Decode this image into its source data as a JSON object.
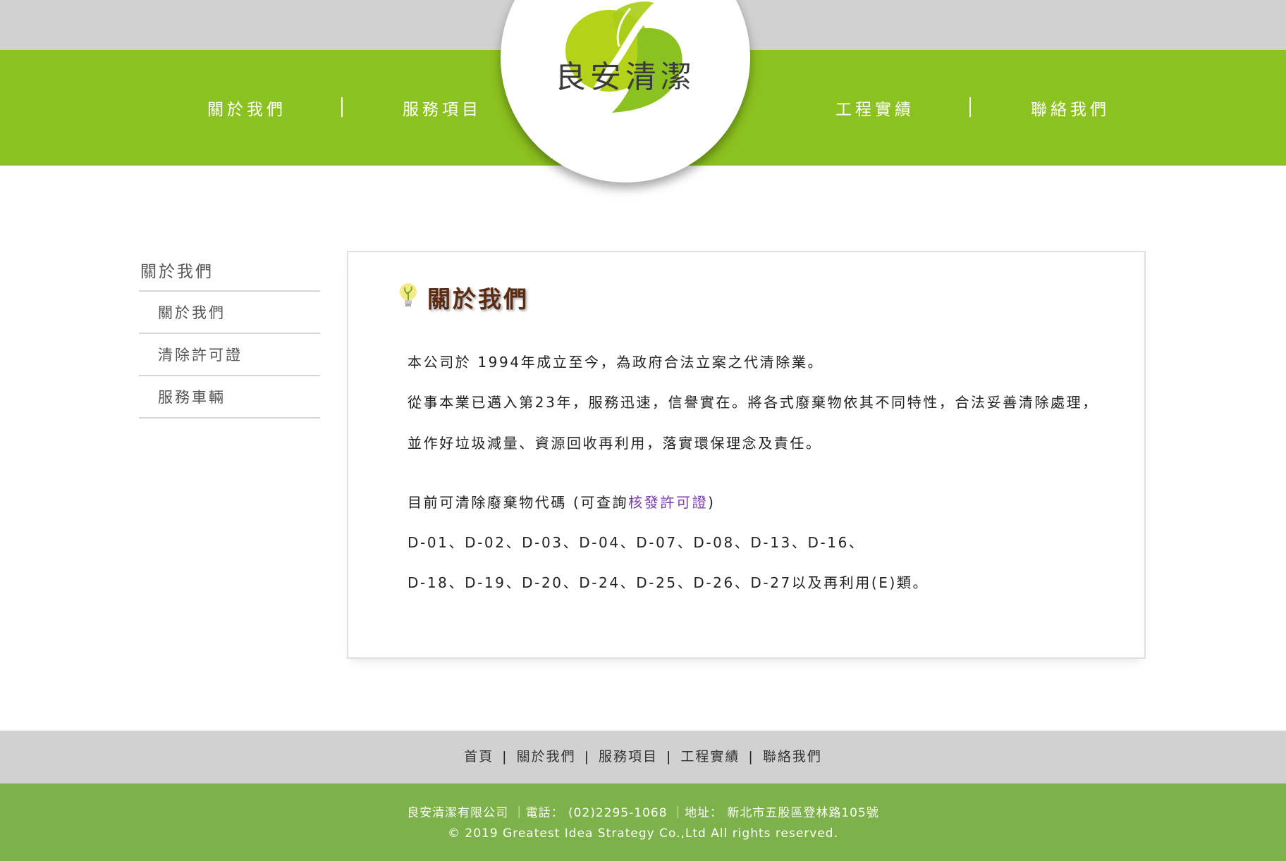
{
  "header": {
    "logo_text": "良安清潔",
    "nav": [
      "關於我們",
      "服務項目",
      "工程實績",
      "聯絡我們"
    ]
  },
  "sidebar": {
    "title": "關於我們",
    "items": [
      {
        "label": "關於我們"
      },
      {
        "label": "清除許可證"
      },
      {
        "label": "服務車輛"
      }
    ]
  },
  "content": {
    "title": "關於我們",
    "paragraphs": [
      "本公司於 1994年成立至今，為政府合法立案之代清除業。",
      "從事本業已邁入第23年，服務迅速，信譽實在。將各式廢棄物依其不同特性，合法妥善清除處理，",
      "並作好垃圾減量、資源回收再利用，落實環保理念及責任。"
    ],
    "codes_intro_prefix": "目前可清除廢棄物代碼 (可查詢",
    "codes_intro_link": "核發許可證",
    "codes_intro_suffix": ")",
    "codes_line1": "D-01、D-02、D-03、D-04、D-07、D-08、D-13、D-16、",
    "codes_line2": "D-18、D-19、D-20、D-24、D-25、D-26、D-27以及再利用(E)類。"
  },
  "footer": {
    "links": [
      "首頁",
      "關於我們",
      "服務項目",
      "工程實績",
      "聯絡我們"
    ],
    "separators": [
      "|",
      "|",
      "|",
      "|"
    ],
    "info_line": "良安清潔有限公司 ｜電話： (02)2295-1068 ｜地址： 新北市五股區登林路105號",
    "copyright": "© 2019 Greatest Idea Strategy Co.,Ltd All rights reserved."
  },
  "colors": {
    "brand_green": "#8cc21f",
    "footer_green": "#7db14a",
    "gray_band": "#d1d1d1",
    "title_brown": "#5a2a12",
    "link_purple": "#7a3ea8"
  }
}
